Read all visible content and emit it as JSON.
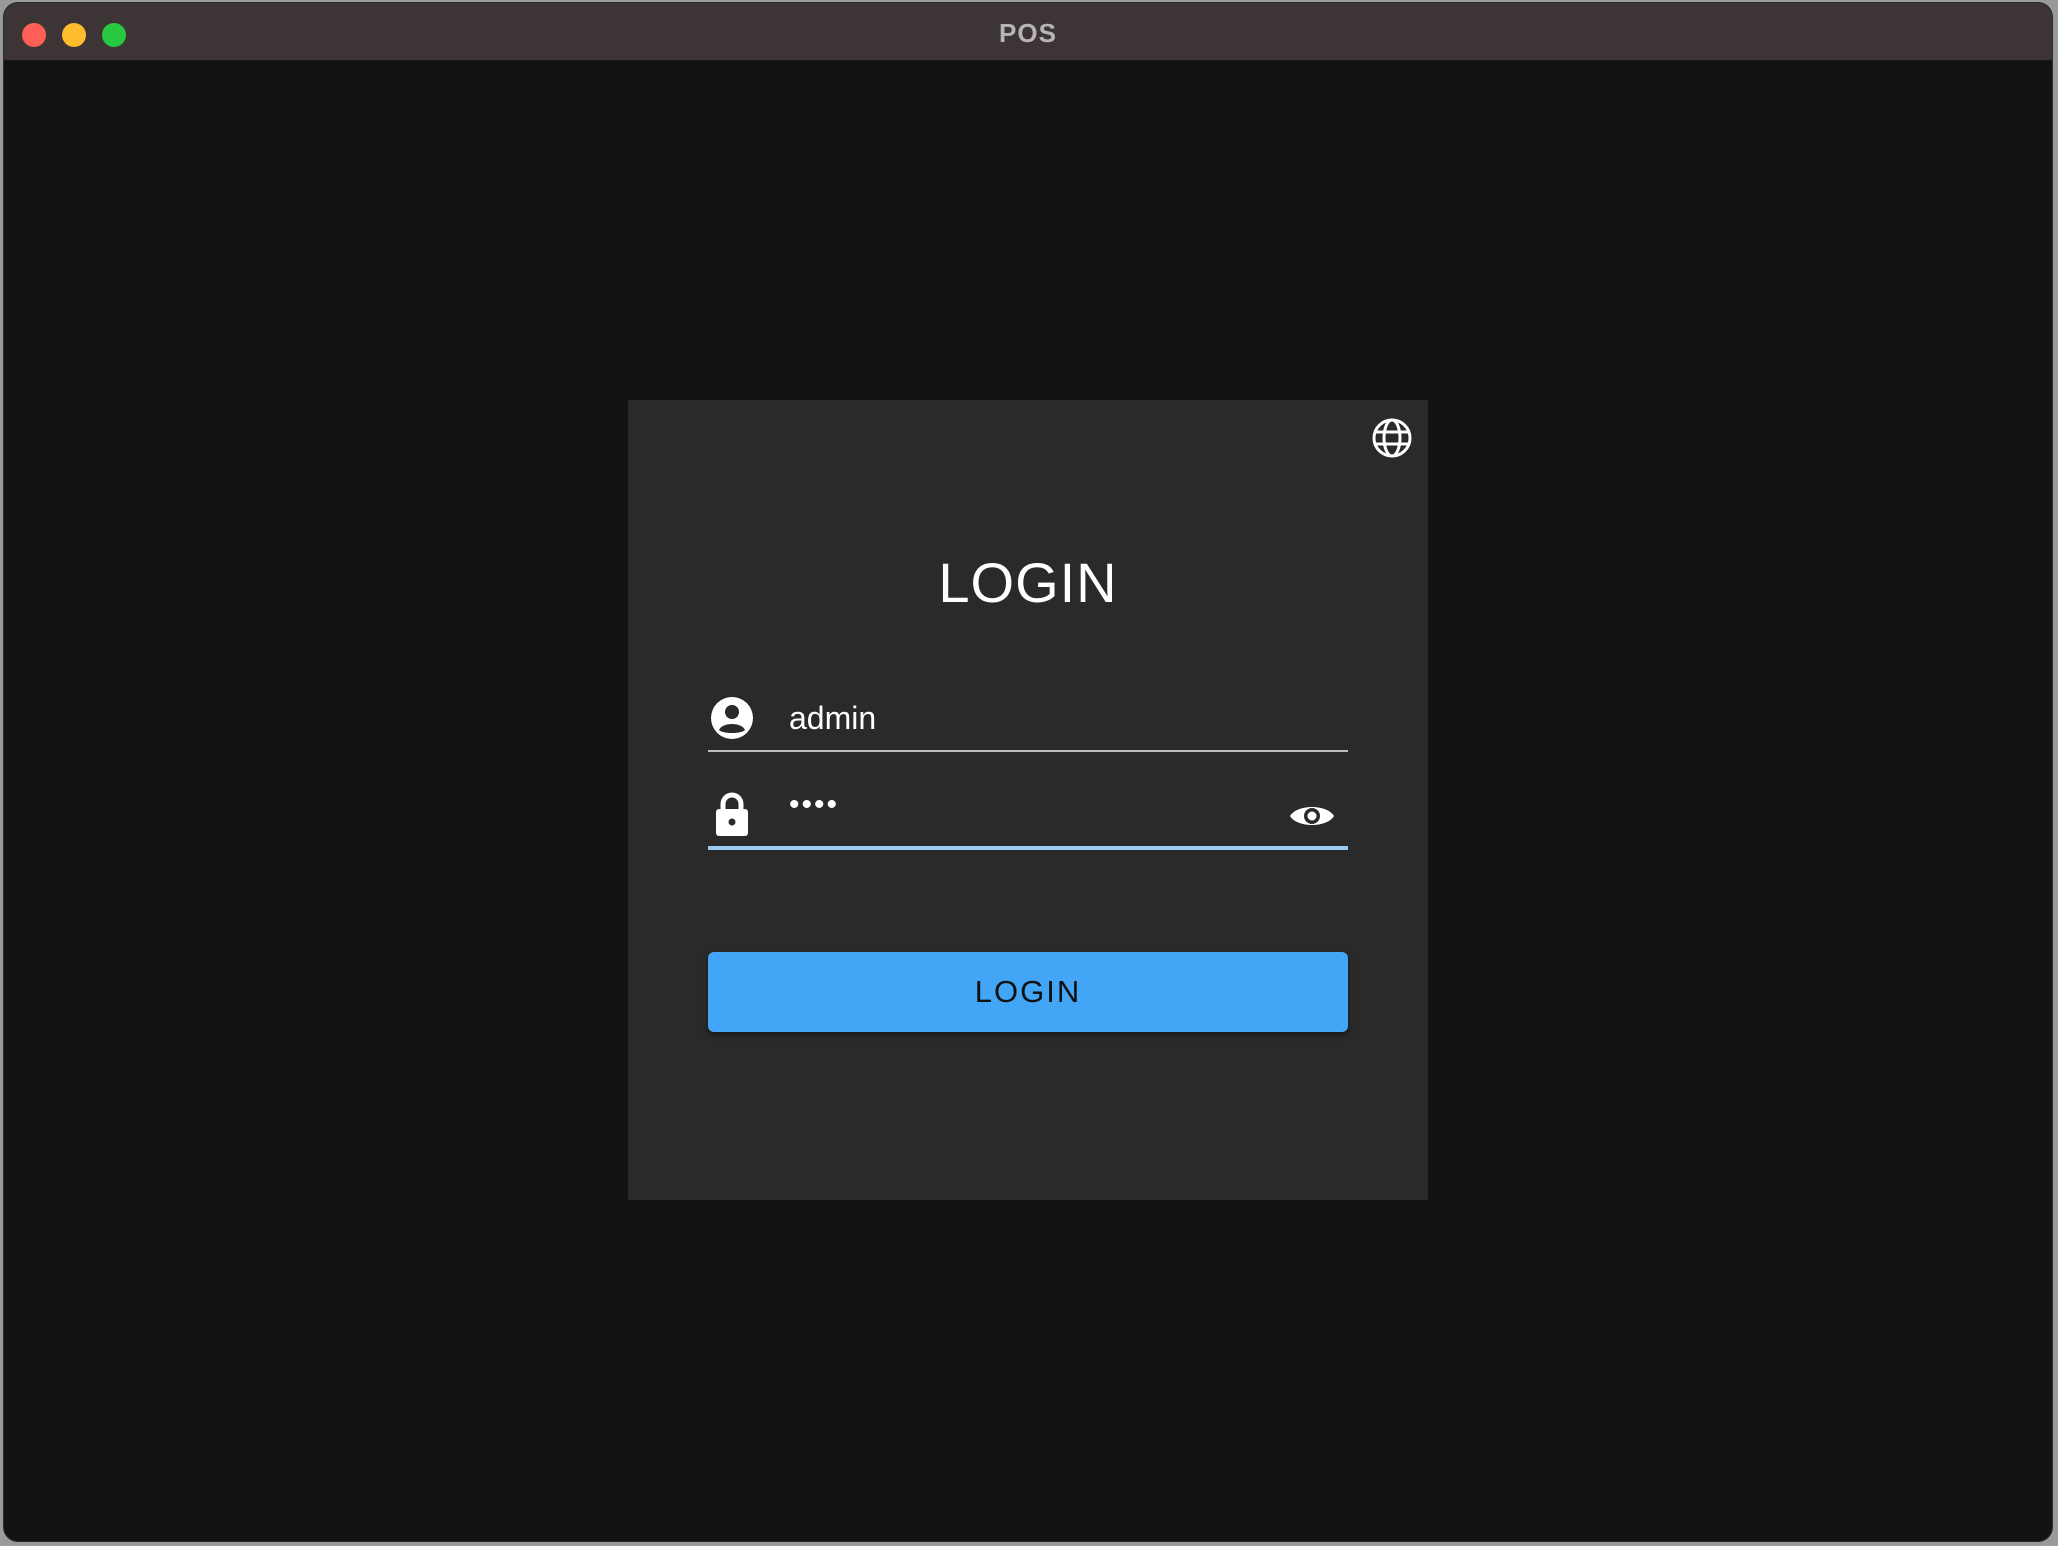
{
  "window": {
    "title": "POS",
    "traffic_lights": {
      "close_color": "#ff5f57",
      "minimize_color": "#febc2e",
      "zoom_color": "#28c840"
    }
  },
  "login_card": {
    "language_icon": "globe-icon",
    "title": "LOGIN",
    "username": {
      "icon": "account-circle-icon",
      "value": "admin"
    },
    "password": {
      "icon": "lock-icon",
      "value": "••••",
      "toggle_icon": "eye-icon"
    },
    "submit_label": "LOGIN"
  },
  "colors": {
    "background": "#121212",
    "card": "#2a2a2b",
    "accent": "#42a5f5",
    "focused_underline": "#9ccbef"
  }
}
